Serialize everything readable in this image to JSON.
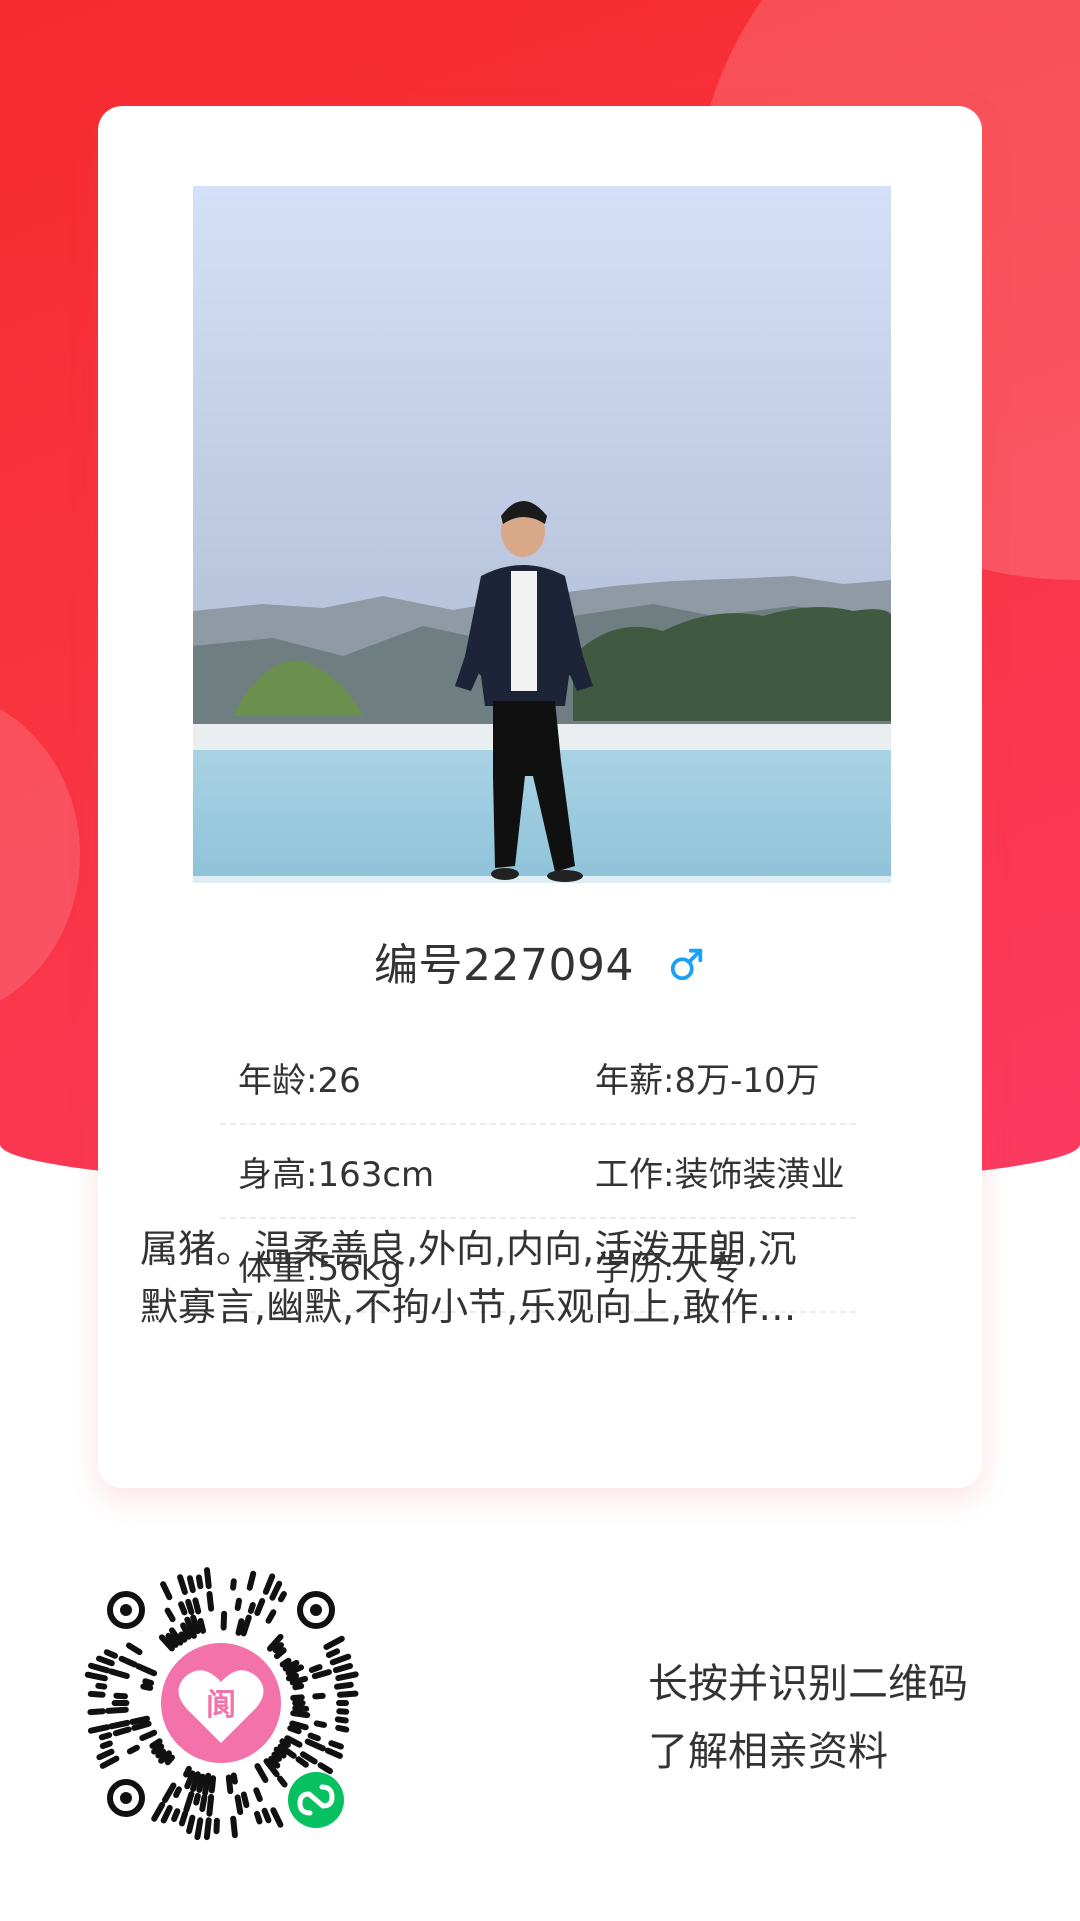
{
  "profile": {
    "title": "编号227094",
    "gender_icon": "male-icon",
    "photo_alt": "profile-photo",
    "rows": [
      {
        "left": "年龄:26",
        "right": "年薪:8万-10万"
      },
      {
        "left": "身高:163cm",
        "right": "工作:装饰装潢业"
      },
      {
        "left": "体重:56kg",
        "right": "学历:大专"
      }
    ],
    "description": "属猪。温柔善良,外向,内向,活泼开朗,沉默寡言,幽默,不拘小节,乐观向上,敢作敢为"
  },
  "footer": {
    "hint_line1": "长按并识别二维码",
    "hint_line2": "了解相亲资料",
    "qr_logo_char": "阆"
  },
  "colors": {
    "brand_red": "#f72a2f",
    "gender_blue": "#1ba1f3",
    "qr_pink": "#f272a9",
    "wechat_green": "#07c160"
  }
}
